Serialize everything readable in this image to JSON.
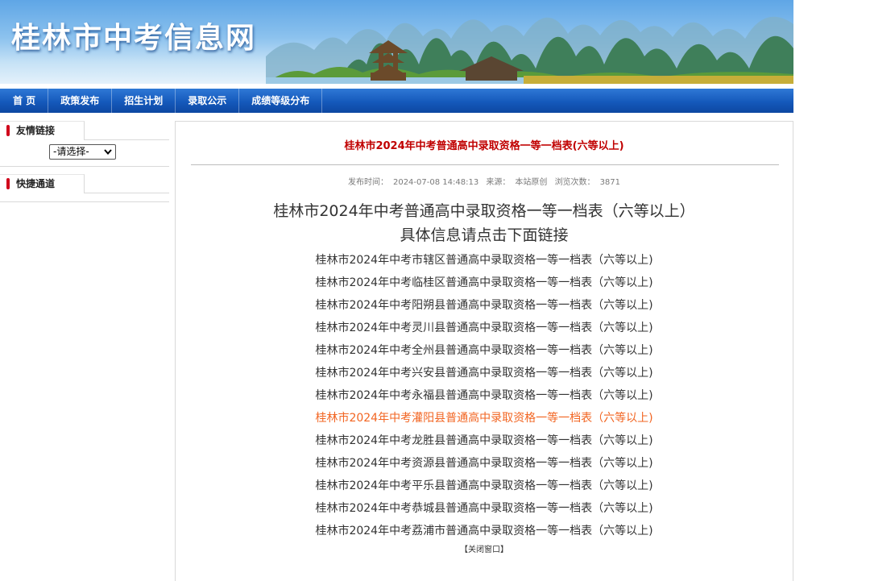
{
  "header": {
    "site_title": "桂林市中考信息网"
  },
  "nav": {
    "items": [
      "首 页",
      "政策发布",
      "招生计划",
      "录取公示",
      "成绩等级分布"
    ]
  },
  "sidebar": {
    "friend_links": {
      "label": "友情链接",
      "select_value": "-请选择-"
    },
    "quick_access": {
      "label": "快捷通道"
    }
  },
  "article": {
    "title": "桂林市2024年中考普通高中录取资格一等一档表(六等以上)",
    "meta": {
      "publish_label": "发布时间：",
      "publish_time": "2024-07-08 14:48:13",
      "source_label": "来源：",
      "source": "本站原创",
      "views_label": "浏览次数：",
      "views": "3871"
    },
    "heading_line1": "桂林市2024年中考普通高中录取资格一等一档表（六等以上）",
    "heading_line2": "具体信息请点击下面链接",
    "links": [
      "桂林市2024年中考市辖区普通高中录取资格一等一档表（六等以上)",
      "桂林市2024年中考临桂区普通高中录取资格一等一档表（六等以上)",
      "桂林市2024年中考阳朔县普通高中录取资格一等一档表（六等以上)",
      "桂林市2024年中考灵川县普通高中录取资格一等一档表（六等以上)",
      "桂林市2024年中考全州县普通高中录取资格一等一档表（六等以上)",
      "桂林市2024年中考兴安县普通高中录取资格一等一档表（六等以上)",
      "桂林市2024年中考永福县普通高中录取资格一等一档表（六等以上)",
      "桂林市2024年中考灌阳县普通高中录取资格一等一档表（六等以上)",
      "桂林市2024年中考龙胜县普通高中录取资格一等一档表（六等以上)",
      "桂林市2024年中考资源县普通高中录取资格一等一档表（六等以上)",
      "桂林市2024年中考平乐县普通高中录取资格一等一档表（六等以上)",
      "桂林市2024年中考恭城县普通高中录取资格一等一档表（六等以上)",
      "桂林市2024年中考荔浦市普通高中录取资格一等一档表（六等以上)"
    ],
    "hovered_link_index": 7,
    "close_label": "【关闭窗口】"
  },
  "colors": {
    "nav_blue": "#1559bb",
    "title_red": "#c00000",
    "link_hover_orange": "#f26522",
    "marker_red": "#d0021b"
  }
}
